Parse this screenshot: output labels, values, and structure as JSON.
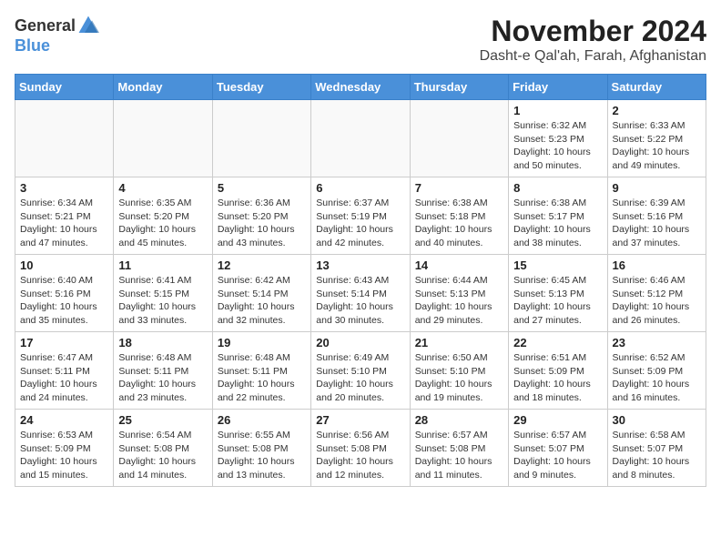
{
  "logo": {
    "general": "General",
    "blue": "Blue"
  },
  "header": {
    "month": "November 2024",
    "location": "Dasht-e Qal'ah, Farah, Afghanistan"
  },
  "weekdays": [
    "Sunday",
    "Monday",
    "Tuesday",
    "Wednesday",
    "Thursday",
    "Friday",
    "Saturday"
  ],
  "weeks": [
    [
      {
        "day": "",
        "detail": ""
      },
      {
        "day": "",
        "detail": ""
      },
      {
        "day": "",
        "detail": ""
      },
      {
        "day": "",
        "detail": ""
      },
      {
        "day": "",
        "detail": ""
      },
      {
        "day": "1",
        "detail": "Sunrise: 6:32 AM\nSunset: 5:23 PM\nDaylight: 10 hours\nand 50 minutes."
      },
      {
        "day": "2",
        "detail": "Sunrise: 6:33 AM\nSunset: 5:22 PM\nDaylight: 10 hours\nand 49 minutes."
      }
    ],
    [
      {
        "day": "3",
        "detail": "Sunrise: 6:34 AM\nSunset: 5:21 PM\nDaylight: 10 hours\nand 47 minutes."
      },
      {
        "day": "4",
        "detail": "Sunrise: 6:35 AM\nSunset: 5:20 PM\nDaylight: 10 hours\nand 45 minutes."
      },
      {
        "day": "5",
        "detail": "Sunrise: 6:36 AM\nSunset: 5:20 PM\nDaylight: 10 hours\nand 43 minutes."
      },
      {
        "day": "6",
        "detail": "Sunrise: 6:37 AM\nSunset: 5:19 PM\nDaylight: 10 hours\nand 42 minutes."
      },
      {
        "day": "7",
        "detail": "Sunrise: 6:38 AM\nSunset: 5:18 PM\nDaylight: 10 hours\nand 40 minutes."
      },
      {
        "day": "8",
        "detail": "Sunrise: 6:38 AM\nSunset: 5:17 PM\nDaylight: 10 hours\nand 38 minutes."
      },
      {
        "day": "9",
        "detail": "Sunrise: 6:39 AM\nSunset: 5:16 PM\nDaylight: 10 hours\nand 37 minutes."
      }
    ],
    [
      {
        "day": "10",
        "detail": "Sunrise: 6:40 AM\nSunset: 5:16 PM\nDaylight: 10 hours\nand 35 minutes."
      },
      {
        "day": "11",
        "detail": "Sunrise: 6:41 AM\nSunset: 5:15 PM\nDaylight: 10 hours\nand 33 minutes."
      },
      {
        "day": "12",
        "detail": "Sunrise: 6:42 AM\nSunset: 5:14 PM\nDaylight: 10 hours\nand 32 minutes."
      },
      {
        "day": "13",
        "detail": "Sunrise: 6:43 AM\nSunset: 5:14 PM\nDaylight: 10 hours\nand 30 minutes."
      },
      {
        "day": "14",
        "detail": "Sunrise: 6:44 AM\nSunset: 5:13 PM\nDaylight: 10 hours\nand 29 minutes."
      },
      {
        "day": "15",
        "detail": "Sunrise: 6:45 AM\nSunset: 5:13 PM\nDaylight: 10 hours\nand 27 minutes."
      },
      {
        "day": "16",
        "detail": "Sunrise: 6:46 AM\nSunset: 5:12 PM\nDaylight: 10 hours\nand 26 minutes."
      }
    ],
    [
      {
        "day": "17",
        "detail": "Sunrise: 6:47 AM\nSunset: 5:11 PM\nDaylight: 10 hours\nand 24 minutes."
      },
      {
        "day": "18",
        "detail": "Sunrise: 6:48 AM\nSunset: 5:11 PM\nDaylight: 10 hours\nand 23 minutes."
      },
      {
        "day": "19",
        "detail": "Sunrise: 6:48 AM\nSunset: 5:11 PM\nDaylight: 10 hours\nand 22 minutes."
      },
      {
        "day": "20",
        "detail": "Sunrise: 6:49 AM\nSunset: 5:10 PM\nDaylight: 10 hours\nand 20 minutes."
      },
      {
        "day": "21",
        "detail": "Sunrise: 6:50 AM\nSunset: 5:10 PM\nDaylight: 10 hours\nand 19 minutes."
      },
      {
        "day": "22",
        "detail": "Sunrise: 6:51 AM\nSunset: 5:09 PM\nDaylight: 10 hours\nand 18 minutes."
      },
      {
        "day": "23",
        "detail": "Sunrise: 6:52 AM\nSunset: 5:09 PM\nDaylight: 10 hours\nand 16 minutes."
      }
    ],
    [
      {
        "day": "24",
        "detail": "Sunrise: 6:53 AM\nSunset: 5:09 PM\nDaylight: 10 hours\nand 15 minutes."
      },
      {
        "day": "25",
        "detail": "Sunrise: 6:54 AM\nSunset: 5:08 PM\nDaylight: 10 hours\nand 14 minutes."
      },
      {
        "day": "26",
        "detail": "Sunrise: 6:55 AM\nSunset: 5:08 PM\nDaylight: 10 hours\nand 13 minutes."
      },
      {
        "day": "27",
        "detail": "Sunrise: 6:56 AM\nSunset: 5:08 PM\nDaylight: 10 hours\nand 12 minutes."
      },
      {
        "day": "28",
        "detail": "Sunrise: 6:57 AM\nSunset: 5:08 PM\nDaylight: 10 hours\nand 11 minutes."
      },
      {
        "day": "29",
        "detail": "Sunrise: 6:57 AM\nSunset: 5:07 PM\nDaylight: 10 hours\nand 9 minutes."
      },
      {
        "day": "30",
        "detail": "Sunrise: 6:58 AM\nSunset: 5:07 PM\nDaylight: 10 hours\nand 8 minutes."
      }
    ]
  ]
}
